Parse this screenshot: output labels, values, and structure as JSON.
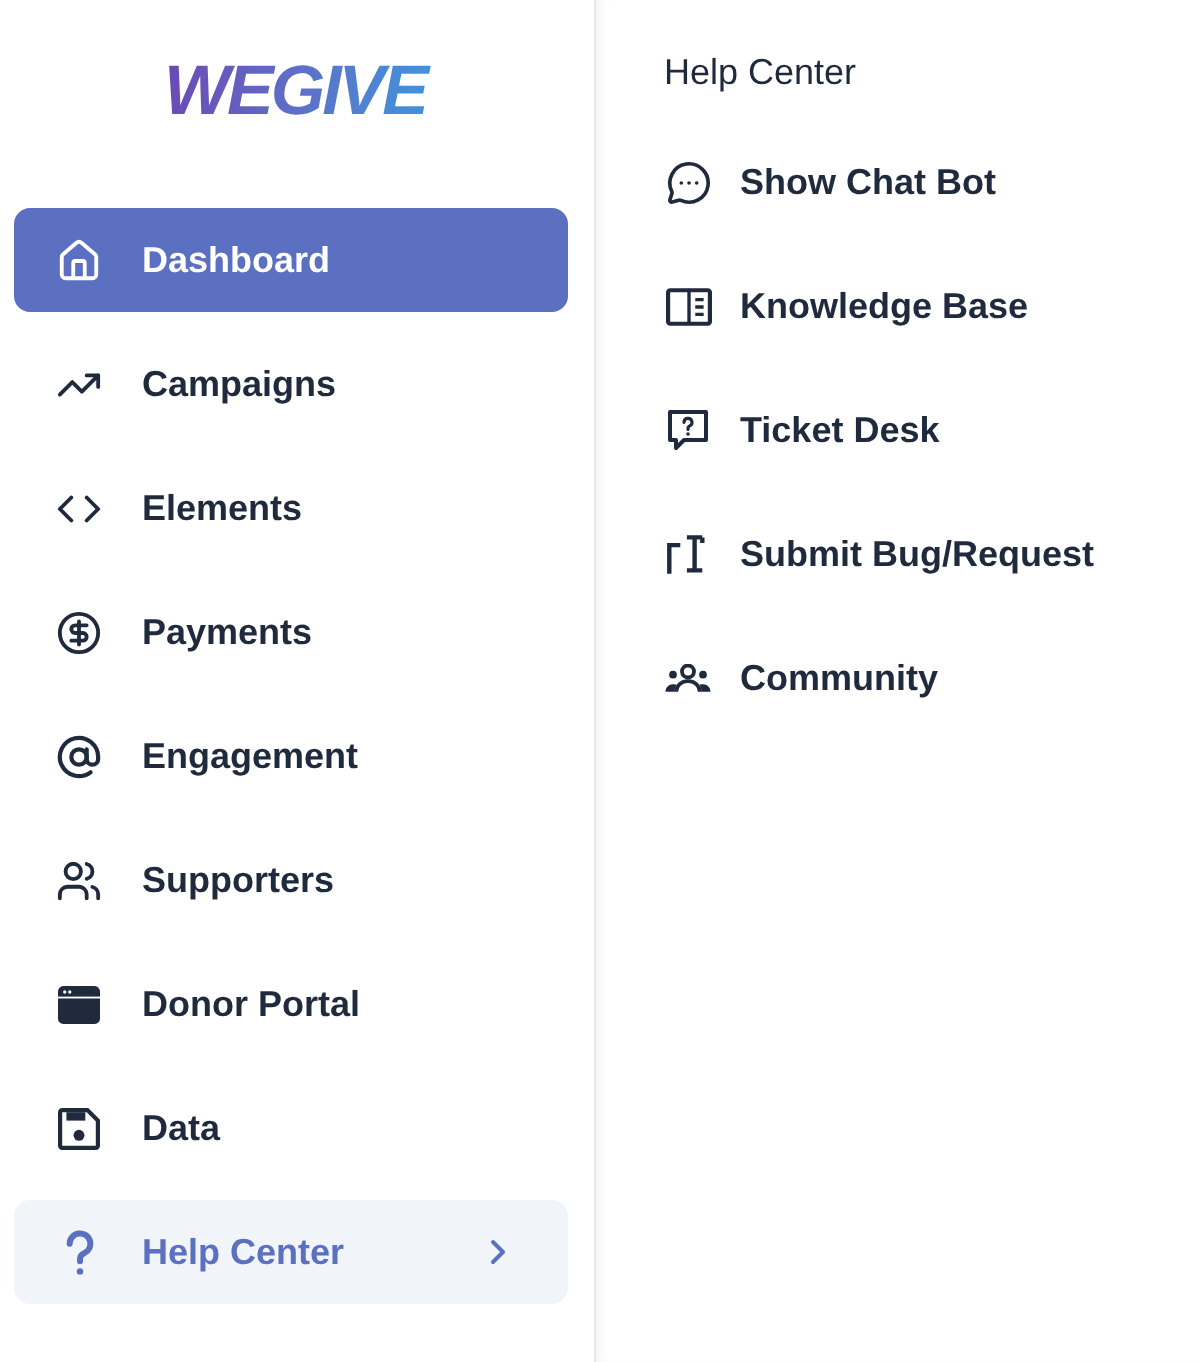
{
  "sidebar": {
    "logo": {
      "text": "WEGIVE"
    },
    "items": [
      {
        "label": "Dashboard",
        "kind": "link",
        "selected": true
      },
      {
        "label": "Campaigns",
        "kind": "link",
        "selected": false
      },
      {
        "label": "Elements",
        "kind": "link",
        "selected": false
      },
      {
        "label": "Payments",
        "kind": "link",
        "selected": false
      },
      {
        "label": "Engagement",
        "kind": "link",
        "selected": false
      },
      {
        "label": "Supporters",
        "kind": "link",
        "selected": false
      },
      {
        "label": "Donor Portal",
        "kind": "link",
        "selected": false
      },
      {
        "label": "Data",
        "kind": "link",
        "selected": false
      },
      {
        "label": "Help Center",
        "kind": "submenu",
        "selected": false,
        "expanded": true
      }
    ]
  },
  "flyout": {
    "title": "Help Center",
    "items": [
      {
        "label": "Show Chat Bot"
      },
      {
        "label": "Knowledge Base"
      },
      {
        "label": "Ticket Desk"
      },
      {
        "label": "Submit Bug/Request"
      },
      {
        "label": "Community"
      }
    ]
  }
}
